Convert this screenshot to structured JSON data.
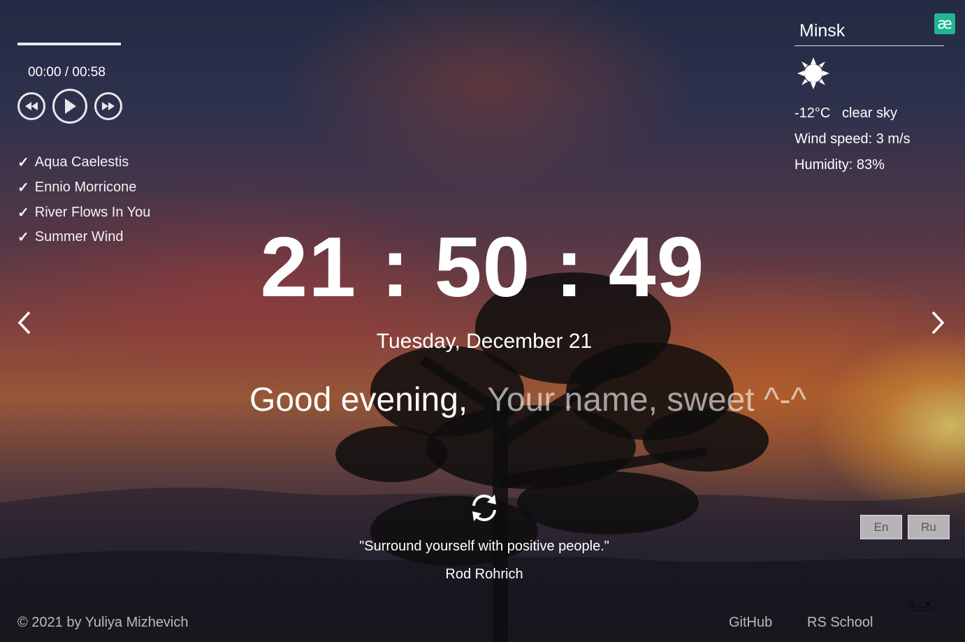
{
  "player": {
    "time": "00:00 / 00:58",
    "progress": 1.0,
    "tracks": [
      "Aqua Caelestis",
      "Ennio Morricone",
      "River Flows In You",
      "Summer Wind"
    ],
    "check_symbol": "✓",
    "icons": {
      "prev": "rewind-icon",
      "play": "play-icon",
      "next": "fast-forward-icon"
    }
  },
  "weather": {
    "city": "Minsk",
    "temperature": "-12°C",
    "description": "clear sky",
    "wind": "Wind speed: 3 m/s",
    "humidity": "Humidity: 83%",
    "icon": "sun-icon"
  },
  "app_badge": "æ",
  "clock": {
    "time": "21 : 50 : 49",
    "date": "Tuesday, December 21"
  },
  "greeting": {
    "text": "Good evening,",
    "name_placeholder": "Your name, sweet ^-^"
  },
  "quote": {
    "text": "\"Surround yourself with positive people.\"",
    "author": "Rod Rohrich"
  },
  "language": {
    "options": [
      "En",
      "Ru"
    ]
  },
  "footer": {
    "copyright": "© 2021 by Yuliya Mizhevich",
    "github": "GitHub",
    "rs_school": "RS School"
  },
  "colors": {
    "badge": "#21b591",
    "text": "#ffffff"
  }
}
